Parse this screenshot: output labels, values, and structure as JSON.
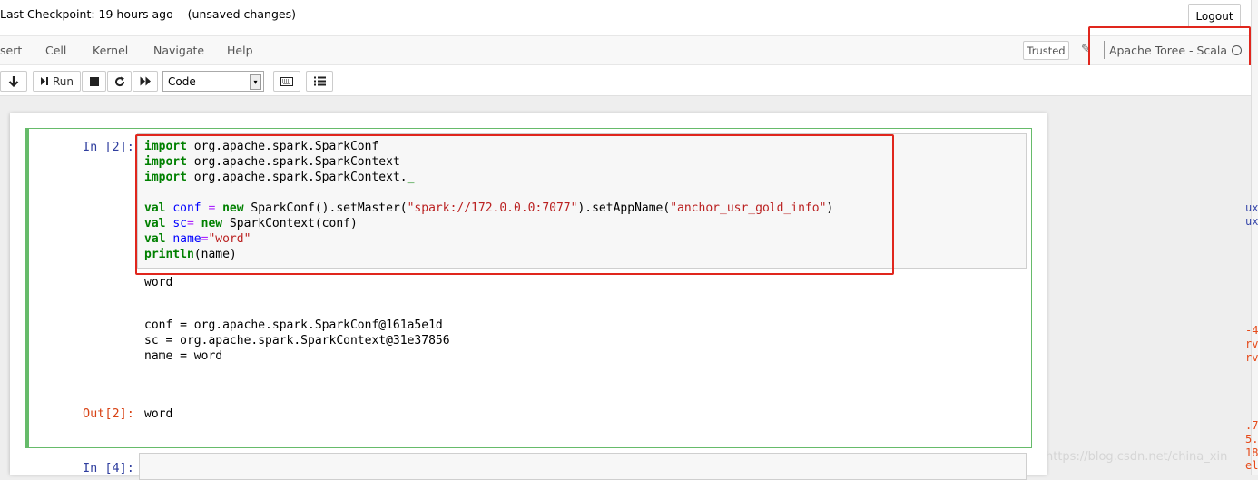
{
  "header": {
    "checkpoint": "Last Checkpoint: 19 hours ago",
    "unsaved": "(unsaved changes)",
    "logout_label": "Logout"
  },
  "menu": {
    "items": [
      "sert",
      "Cell",
      "Kernel",
      "Navigate",
      "Help"
    ],
    "trusted_label": "Trusted",
    "kernel_name": "Apache Toree - Scala"
  },
  "toolbar": {
    "run_label": "Run",
    "cell_type": "Code",
    "icons": [
      "move-down-icon",
      "run-icon",
      "stop-icon",
      "restart-icon",
      "fast-forward-icon",
      "keyboard-icon",
      "list-icon"
    ]
  },
  "cells": [
    {
      "prompt": "In [2]:",
      "code_lines": [
        "import org.apache.spark.SparkConf",
        "import org.apache.spark.SparkContext",
        "import org.apache.spark.SparkContext._",
        "",
        "val conf = new SparkConf().setMaster(\"spark://172.0.0.0:7077\").setAppName(\"anchor_usr_gold_info\")",
        "val sc= new SparkContext(conf)",
        "val name=\"word\"",
        "println(name)"
      ],
      "stdout": "word",
      "display_lines": [
        "conf = org.apache.spark.SparkConf@161a5e1d",
        "sc = org.apache.spark.SparkContext@31e37856",
        "name = word"
      ],
      "out_prompt": "Out[2]:",
      "out_value": "word"
    },
    {
      "prompt": "In [4]:"
    }
  ],
  "side_fragments": [
    "ux",
    "ux",
    "-4",
    "rv",
    "rv",
    ".7",
    "5.",
    "18",
    "el"
  ],
  "watermark": "https://blog.csdn.net/china_xin",
  "colors": {
    "highlight": "#e0261d",
    "selected_border": "#66bb6a",
    "keyword": "#008000",
    "string": "#ba2121",
    "prompt_in": "#303f9f",
    "prompt_out": "#d84315"
  }
}
